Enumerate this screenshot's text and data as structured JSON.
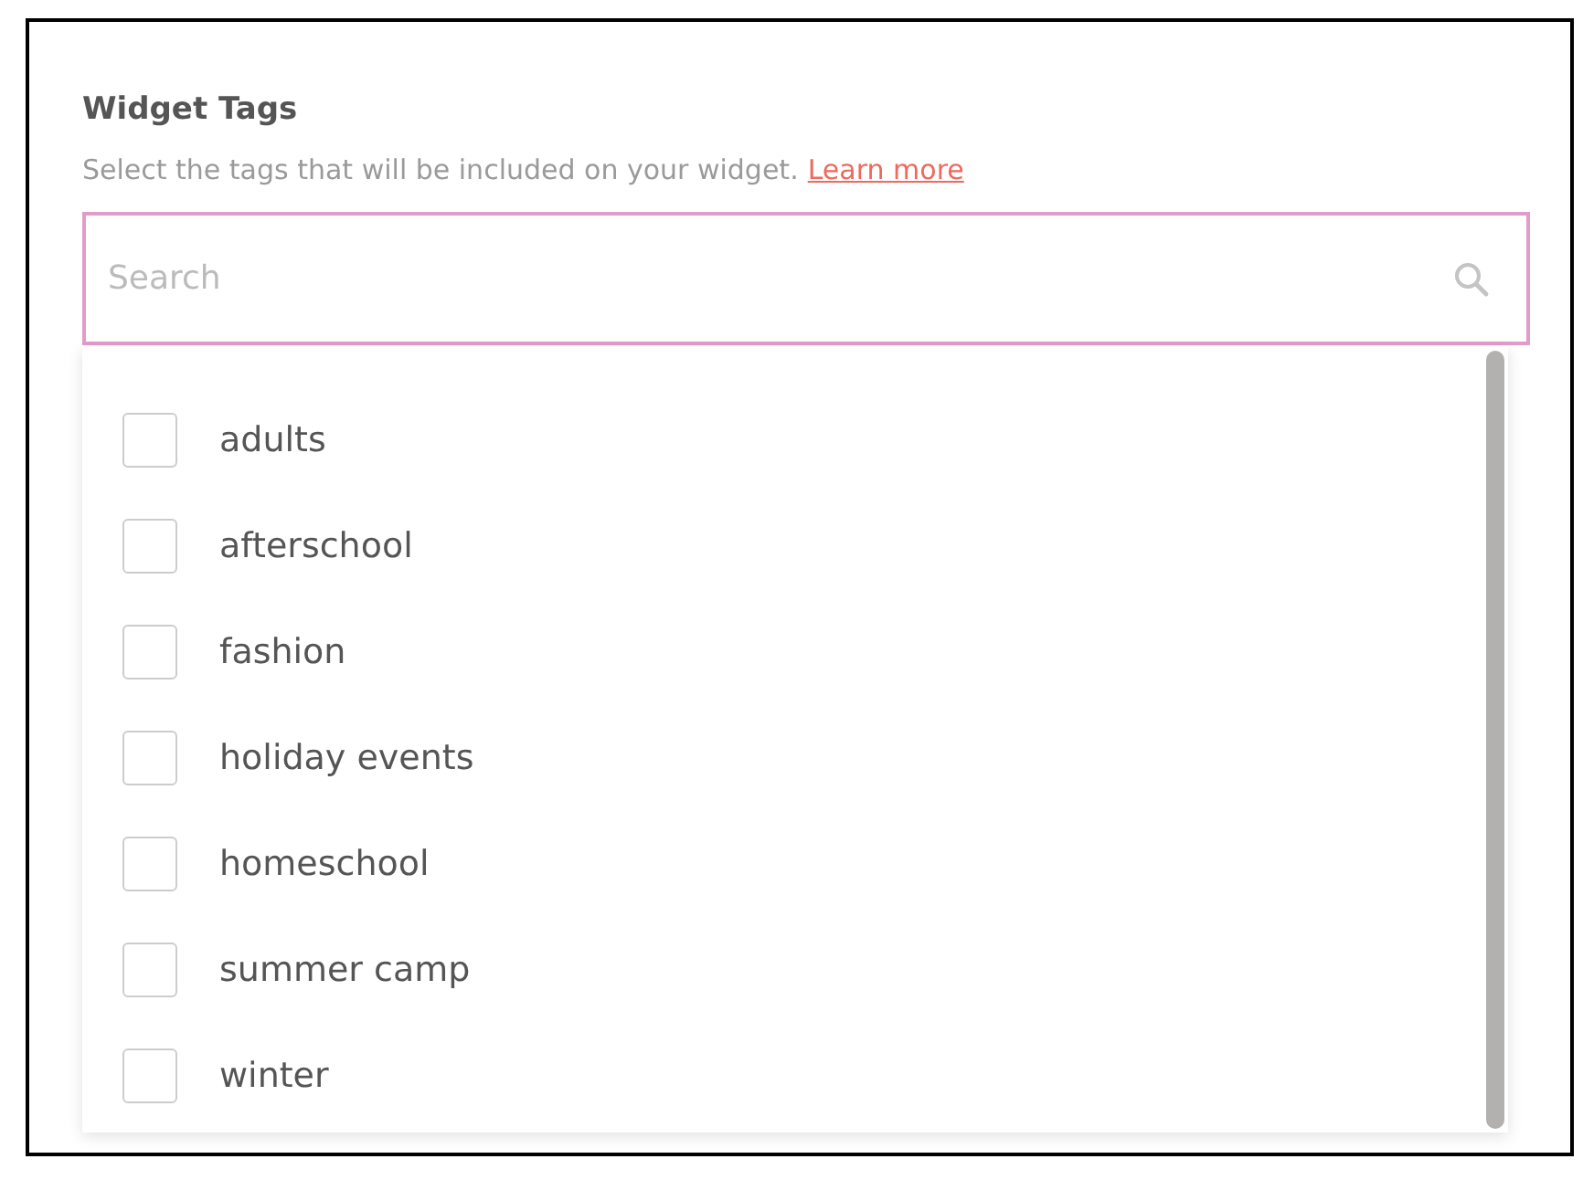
{
  "title": "Widget Tags",
  "description": {
    "text": "Select the tags that will be included on your widget.",
    "link": "Learn more"
  },
  "search": {
    "placeholder": "Search"
  },
  "tags": [
    {
      "label": "adults",
      "checked": false
    },
    {
      "label": "afterschool",
      "checked": false
    },
    {
      "label": "fashion",
      "checked": false
    },
    {
      "label": "holiday events",
      "checked": false
    },
    {
      "label": "homeschool",
      "checked": false
    },
    {
      "label": "summer camp",
      "checked": false
    },
    {
      "label": "winter",
      "checked": false
    }
  ]
}
